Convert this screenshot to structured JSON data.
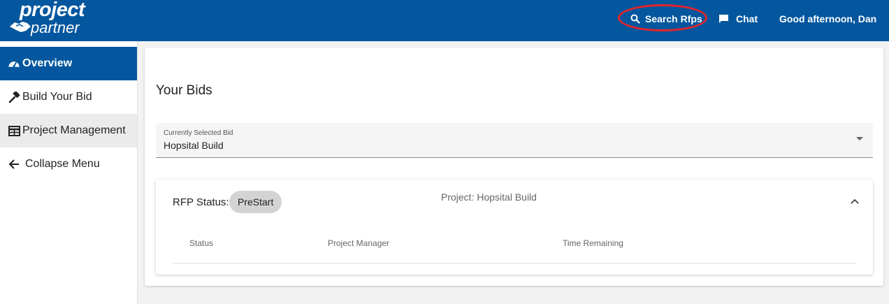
{
  "header": {
    "logo_word1": "project",
    "logo_word2": "partner",
    "search_label": "Search Rfps",
    "chat_label": "Chat",
    "greeting": "Good afternoon, Dan"
  },
  "sidebar": {
    "items": [
      {
        "label": "Overview",
        "icon": "dashboard-icon",
        "active": true
      },
      {
        "label": "Build Your Bid",
        "icon": "hammer-icon"
      },
      {
        "label": "Project Management",
        "icon": "table-icon"
      },
      {
        "label": "Collapse Menu",
        "icon": "arrow-left-icon"
      }
    ]
  },
  "main": {
    "title": "Your Bids",
    "bid_select": {
      "label": "Currently Selected Bid",
      "value": "Hopsital Build"
    },
    "bid_card": {
      "rfp_status_label": "RFP Status:",
      "status": "PreStart",
      "project": "Project: Hopsital Build",
      "columns": [
        "Status",
        "Project Manager",
        "Time Remaining"
      ]
    }
  },
  "colors": {
    "brand_blue": "#04579e",
    "highlight_red": "#e3242b",
    "chip_gray": "#d3d3d3"
  }
}
